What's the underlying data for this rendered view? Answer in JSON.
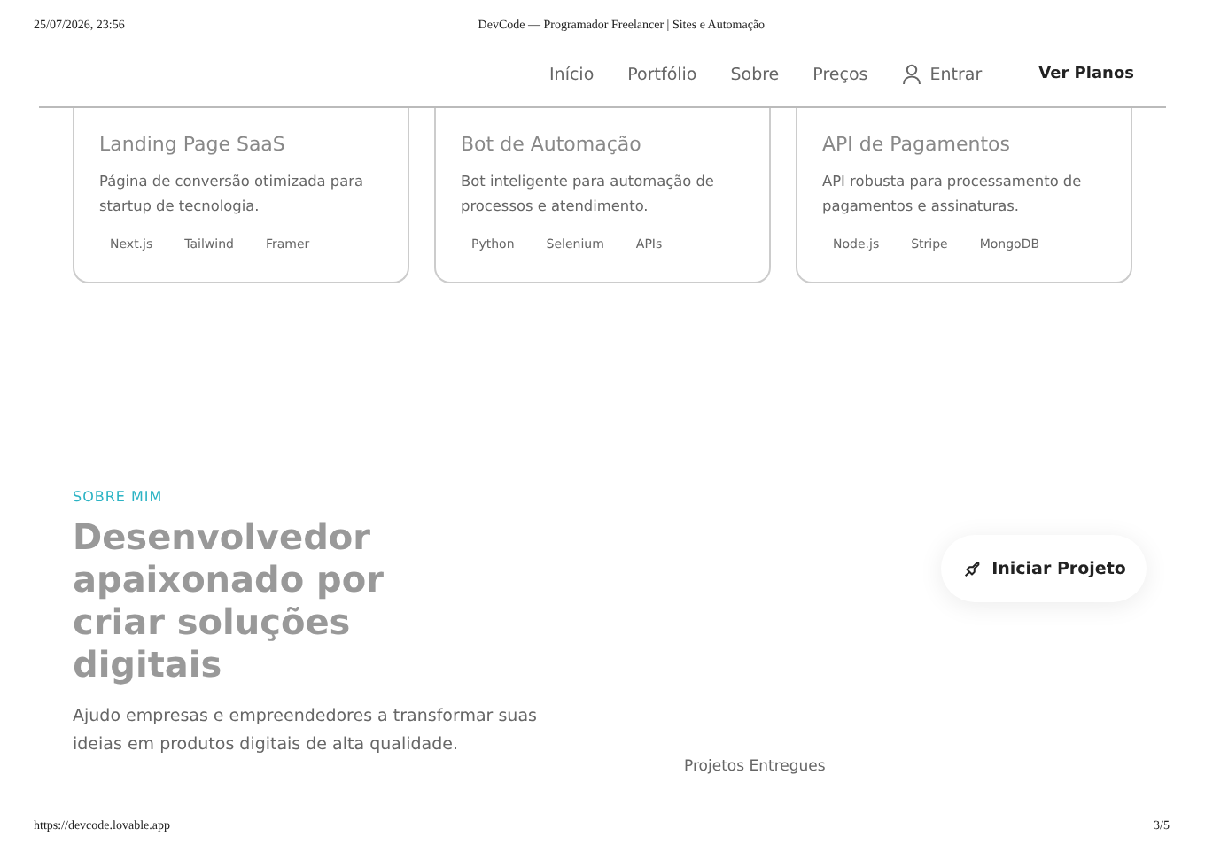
{
  "print_header": {
    "date": "25/07/2026, 23:56",
    "title": "DevCode — Programador Freelancer | Sites e Automação"
  },
  "nav": {
    "links": [
      "Início",
      "Portfólio",
      "Sobre",
      "Preços"
    ],
    "login": "Entrar",
    "cta": "Ver Planos"
  },
  "projects": [
    {
      "title": "Landing Page SaaS",
      "description": "Página de conversão otimizada para startup de tecnologia.",
      "tags": [
        "Next.js",
        "Tailwind",
        "Framer"
      ]
    },
    {
      "title": "Bot de Automação",
      "description": "Bot inteligente para automação de processos e atendimento.",
      "tags": [
        "Python",
        "Selenium",
        "APIs"
      ]
    },
    {
      "title": "API de Pagamentos",
      "description": "API robusta para processamento de pagamentos e assinaturas.",
      "tags": [
        "Node.js",
        "Stripe",
        "MongoDB"
      ]
    }
  ],
  "about": {
    "eyebrow": "SOBRE MIM",
    "heading": "Desenvolvedor apaixonado por criar soluções digitais",
    "text": "Ajudo empresas e empreendedores a transformar suas ideias em produtos digitais de alta qualidade.",
    "stat_label": "Projetos Entregues"
  },
  "floating_button": "Iniciar Projeto",
  "print_footer": {
    "url": "https://devcode.lovable.app",
    "page": "3/5"
  }
}
